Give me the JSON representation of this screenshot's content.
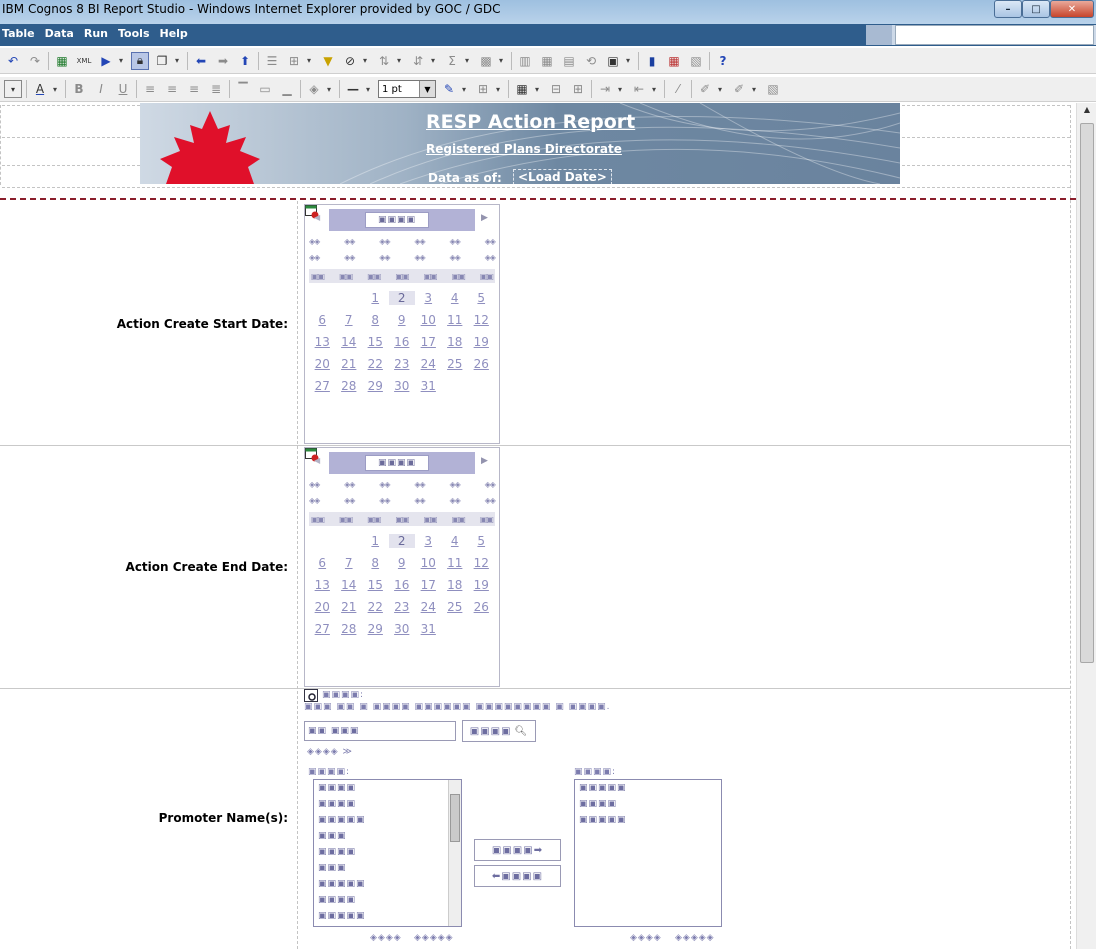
{
  "window": {
    "title": "IBM Cognos 8 BI Report Studio - Windows Internet Explorer provided by GOC / GDC",
    "minimize_glyph": "–",
    "maximize_glyph": "□",
    "close_glyph": "✕"
  },
  "menu": {
    "items": [
      "Table",
      "Data",
      "Run",
      "Tools",
      "Help"
    ]
  },
  "toolbar1": {
    "icons": [
      "undo-icon",
      "redo-icon",
      "excel-icon",
      "xml-icon",
      "run-icon",
      "lock-icon",
      "copy-icon",
      "back-icon",
      "forward-icon",
      "up-icon",
      "list-icon",
      "tree-icon",
      "filter-icon",
      "suppress-icon",
      "sort-asc-icon",
      "sort-desc-icon",
      "sum-icon",
      "calc-icon",
      "group-icon",
      "columns-icon",
      "crosstab-icon",
      "pivot-icon",
      "layout-icon",
      "chart-icon",
      "insert-icon",
      "query-icon",
      "help-icon"
    ]
  },
  "toolbar2": {
    "font_size": "1 pt",
    "icons": [
      "font-color-icon",
      "bold-icon",
      "italic-icon",
      "underline-icon",
      "align-left-icon",
      "align-center-icon",
      "align-right-icon",
      "justify-icon",
      "cell-top-icon",
      "cell-middle-icon",
      "cell-bottom-icon",
      "fill-icon",
      "line-icon",
      "pen-icon",
      "border-icon",
      "table-icon",
      "merge-icon",
      "split-icon",
      "indent-icon",
      "outdent-icon",
      "wand-icon",
      "pick-icon",
      "style-icon",
      "format-icon"
    ],
    "bold": "B",
    "italic": "I",
    "underline": "U",
    "font_color_letter": "A"
  },
  "banner": {
    "title": "RESP Action Report",
    "subtitle": "Registered Plans Directorate",
    "data_as_of": "Data as of:",
    "load_date": "<Load Date>"
  },
  "start_date": {
    "label": "Action Create Start Date:",
    "month_placeholder": "▣▣▣▣",
    "dow": [
      "▣▣",
      "▣▣",
      "▣▣",
      "▣▣",
      "▣▣",
      "▣▣",
      "▣▣"
    ],
    "weeks": [
      [
        "",
        "",
        "1",
        "2",
        "3",
        "4",
        "5"
      ],
      [
        "6",
        "7",
        "8",
        "9",
        "10",
        "11",
        "12"
      ],
      [
        "13",
        "14",
        "15",
        "16",
        "17",
        "18",
        "19"
      ],
      [
        "20",
        "21",
        "22",
        "23",
        "24",
        "25",
        "26"
      ],
      [
        "27",
        "28",
        "29",
        "30",
        "31",
        "",
        ""
      ]
    ],
    "selected_day": "2"
  },
  "end_date": {
    "label": "Action Create End Date:",
    "month_placeholder": "▣▣▣▣",
    "weeks": [
      [
        "",
        "",
        "1",
        "2",
        "3",
        "4",
        "5"
      ],
      [
        "6",
        "7",
        "8",
        "9",
        "10",
        "11",
        "12"
      ],
      [
        "13",
        "14",
        "15",
        "16",
        "17",
        "18",
        "19"
      ],
      [
        "20",
        "21",
        "22",
        "23",
        "24",
        "25",
        "26"
      ],
      [
        "27",
        "28",
        "29",
        "30",
        "31",
        "",
        ""
      ]
    ],
    "selected_day": "2"
  },
  "promoter": {
    "label": "Promoter Name(s):",
    "keywords_label": "▣▣▣▣:",
    "instructions": "▣▣▣ ▣▣ ▣ ▣▣▣▣ ▣▣▣▣▣▣ ▣▣▣▣▣▣▣▣ ▣ ▣▣▣▣.",
    "search_value": "▣▣ ▣▣▣",
    "search_button": "▣▣▣▣",
    "options_link": "◈◈◈◈ ≫",
    "results_label": "▣▣▣▣:",
    "results": [
      "▣▣▣▣",
      "▣▣▣▣",
      "▣▣▣▣▣",
      "▣▣▣",
      "▣▣▣▣",
      "▣▣▣",
      "▣▣▣▣▣",
      "▣▣▣▣",
      "▣▣▣▣▣"
    ],
    "choices_label": "▣▣▣▣:",
    "choices": [
      "▣▣▣▣▣",
      "▣▣▣▣",
      "▣▣▣▣▣"
    ],
    "insert_button": "▣▣▣▣➡",
    "remove_button": "⬅▣▣▣▣",
    "select_all_left": "◈◈◈◈",
    "deselect_all_left": "◈◈◈◈◈",
    "select_all_right": "◈◈◈◈",
    "deselect_all_right": "◈◈◈◈◈"
  }
}
